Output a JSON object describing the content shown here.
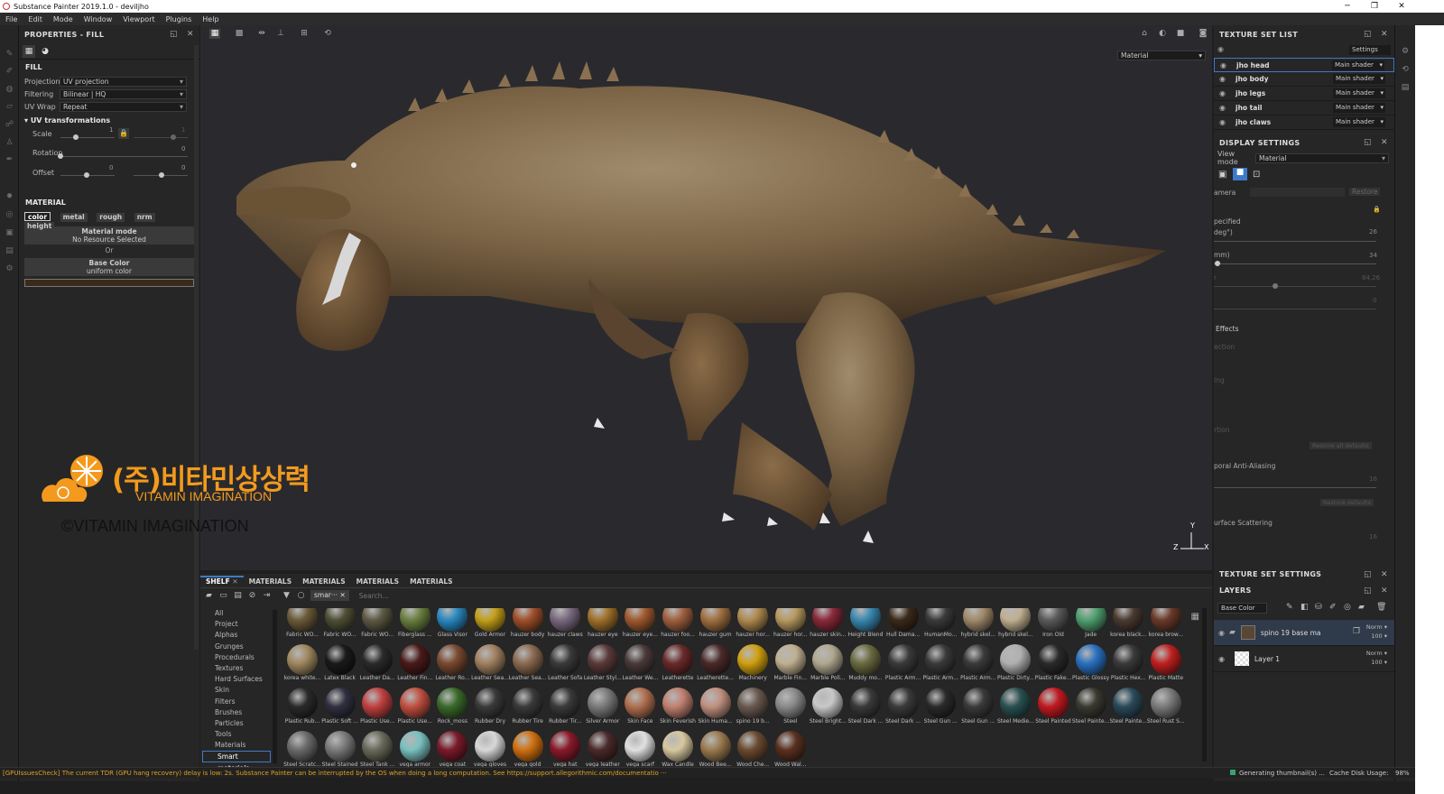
{
  "window": {
    "title": "Substance Painter 2019.1.0 - deviljho",
    "minimize": "─",
    "maximize": "❐",
    "close": "✕"
  },
  "menu": [
    "File",
    "Edit",
    "Mode",
    "Window",
    "Viewport",
    "Plugins",
    "Help"
  ],
  "props": {
    "title": "PROPERTIES - FILL",
    "fill_title": "FILL",
    "projection_label": "Projection",
    "projection_value": "UV projection",
    "filtering_label": "Filtering",
    "filtering_value": "Bilinear | HQ",
    "uvwrap_label": "UV Wrap",
    "uvwrap_value": "Repeat",
    "uvt_title": "UV transformations",
    "scale_label": "Scale",
    "scale_value": "1",
    "scale_value2": "1",
    "rotation_label": "Rotation",
    "rotation_value": "0",
    "offset_label": "Offset",
    "offset_value1": "0",
    "offset_value2": "0",
    "scale_level": 0.29,
    "scale2_level": 0.74,
    "rotation_level": 0,
    "offset1_level": 0.48,
    "offset2_level": 0.52,
    "material_title": "MATERIAL",
    "channels": [
      "color",
      "metal",
      "rough",
      "nrm",
      "height"
    ],
    "material_mode": "Material mode",
    "no_resource": "No Resource Selected",
    "or": "Or",
    "base_color": "Base Color",
    "uniform_color": "uniform color",
    "swatch_color": "#3a2a1a"
  },
  "viewport": {
    "view_mode": "Material",
    "axis_y": "Y",
    "axis_z": "Z",
    "axis_x": "X"
  },
  "logo": {
    "korean": "(주)비타민상상력",
    "english": "VITAMIN IMAGINATION",
    "copyright": "©VITAMIN IMAGINATION",
    "color": "#f39a1e"
  },
  "shelf": {
    "tabs": [
      "SHELF",
      "MATERIALS",
      "MATERIALS",
      "MATERIALS",
      "MATERIALS"
    ],
    "filter_tag": "smar···",
    "search_placeholder": "Search...",
    "categories": [
      "All",
      "Project",
      "Alphas",
      "Grunges",
      "Procedurals",
      "Textures",
      "Hard Surfaces",
      "Skin",
      "Filters",
      "Brushes",
      "Particles",
      "Tools",
      "Materials",
      "Smart materials"
    ],
    "selected_category": "Smart materials",
    "rows": [
      [
        "Fabric WO...",
        "Fabric WO...",
        "Fabric WO...",
        "Fiberglass ...",
        "Glass Visor",
        "Gold Armor",
        "hauzer body",
        "hauzer claws",
        "hauzer eye",
        "hauzer eye...",
        "hauzer foo...",
        "hauzer gum",
        "hauzer hor...",
        "hauzer hor...",
        "hauzer skin...",
        "Height Blend",
        "Hull Dama...",
        "HumanMo...",
        "hybrid skel...",
        "hybrid skel...",
        "Iron Old",
        "Jade",
        "korea black...",
        "korea brow..."
      ],
      [
        "korea white...",
        "Latex Black",
        "Leather Da...",
        "Leather Fin...",
        "Leather Ro...",
        "Leather Sea...",
        "Leather Sea...",
        "Leather Sofa",
        "Leather Styl...",
        "Leather We...",
        "Leatherette",
        "Leatherette...",
        "Machinery",
        "Marble Fin...",
        "Marble Poli...",
        "Muddy mo...",
        "Plastic Arm...",
        "Plastic Arm...",
        "Plastic Arm...",
        "Plastic Dirty...",
        "Plastic Fake...",
        "Plastic Glossy",
        "Plastic Hex...",
        "Plastic Matte"
      ],
      [
        "Plastic Rub...",
        "Plastic Soft ...",
        "Plastic Use...",
        "Plastic Use...",
        "Rock_moss",
        "Rubber Dry",
        "Rubber Tire",
        "Rubber Tir...",
        "Silver Armor",
        "Skin Face",
        "Skin Feverish",
        "Skin Huma...",
        "spino 19 b...",
        "Steel",
        "Steel Bright...",
        "Steel Dark ...",
        "Steel Dark ...",
        "Steel Gun ...",
        "Steel Gun ...",
        "Steel Medie...",
        "Steel Painted",
        "Steel Painte...",
        "Steel Painte...",
        "Steel Rust S..."
      ],
      [
        "Steel Scratc...",
        "Steel Stained",
        "Steel Tank ...",
        "vega armor",
        "vega coat",
        "vega gloves",
        "vega gold",
        "vega hat",
        "vega leather",
        "vega scarf",
        "Wax Candle",
        "Wood Bee...",
        "Wood Che...",
        "Wood Wal..."
      ]
    ],
    "colors": [
      [
        "#6b5b3a",
        "#4f4f36",
        "#5e5a44",
        "#6a8040",
        "#2a88c0",
        "#c4a01a",
        "#a0502a",
        "#7a6a80",
        "#a0702a",
        "#a05a30",
        "#a06040",
        "#a07040",
        "#b08a50",
        "#b89a60",
        "#8a2a3a",
        "#3a88b0",
        "#3a2a1a",
        "#3a3a3a",
        "#a08a6a",
        "#c0b090",
        "#5a5a5a",
        "#50a070",
        "#4a3a30",
        "#6a3a2a"
      ],
      [
        "#a08860",
        "#1a1a1a",
        "#2a2a2a",
        "#4a1a1a",
        "#7a4a30",
        "#a08060",
        "#8a6a50",
        "#3a3a3a",
        "#5a3a3a",
        "#4a3a3a",
        "#6a2a2a",
        "#4a2a2a",
        "#d0a010",
        "#c0b090",
        "#b0a890",
        "#6a6a40",
        "#3a3a3a",
        "#3a3a3a",
        "#3a3a3a",
        "#b0b0b0",
        "#2a2a2a",
        "#2a70c0",
        "#3a3a3a",
        "#c02020"
      ],
      [
        "#2a2a2a",
        "#303040",
        "#c04040",
        "#c05040",
        "#3a6a2a",
        "#3a3a3a",
        "#3a3a3a",
        "#3a3a3a",
        "#7a7a7a",
        "#b07050",
        "#c08070",
        "#c09080",
        "#6a5a50",
        "#8a8a8a",
        "#c8c8c8",
        "#3a3a3a",
        "#3a3a3a",
        "#2a2a2a",
        "#3a3a3a",
        "#2a5050",
        "#c01a20",
        "#3a3a30",
        "#2a4a5a",
        "#7a7a7a"
      ],
      [
        "#6a6a6a",
        "#7a7a7a",
        "#6a6a5a",
        "#7ac0c0",
        "#7a1a2a",
        "#d8d8d8",
        "#d07010",
        "#8a1a2a",
        "#4a2a2a",
        "#e0e0e0",
        "#d8c8a0",
        "#9a7a50",
        "#6a4a30",
        "#5a3020"
      ]
    ]
  },
  "texture_set_list": {
    "title": "TEXTURE SET LIST",
    "settings": "Settings",
    "items": [
      {
        "name": "jho head",
        "shader": "Main shader"
      },
      {
        "name": "jho body",
        "shader": "Main shader"
      },
      {
        "name": "jho legs",
        "shader": "Main shader"
      },
      {
        "name": "jho tail",
        "shader": "Main shader"
      },
      {
        "name": "jho claws",
        "shader": "Main shader"
      }
    ]
  },
  "display_settings": {
    "title": "DISPLAY SETTINGS",
    "view_mode_label": "View mode",
    "view_mode_value": "Material",
    "camera": "amera",
    "restore": "Restore",
    "specified": "pecified",
    "deg": "deg°)",
    "deg_value": "26",
    "mm": "mm)",
    "mm_value": "34",
    "v3": "84,26",
    "v4": "0",
    "effects": "Effects",
    "ection": "ection",
    "ing": "ing",
    "rtion": "rtion",
    "restore_all": "Restore all defaults",
    "aa": "poral Anti-Aliasing",
    "aa_value": "16",
    "surface": "urface Scattering",
    "surface_value": "16",
    "restore_defaults": "Restore defaults",
    "mm_level": 0.02,
    "v3_level": 0.38
  },
  "texture_set_settings": {
    "title": "TEXTURE SET SETTINGS"
  },
  "layers": {
    "title": "LAYERS",
    "channel": "Base Color",
    "items": [
      {
        "name": "spino 19 base ma",
        "blend": "Norm",
        "opacity": "100"
      },
      {
        "name": "Layer 1",
        "blend": "Norm",
        "opacity": "100"
      }
    ]
  },
  "status": {
    "message": "[GPUIssuesCheck] The current TDR (GPU hang recovery) delay is low: 2s. Substance Painter can be interrupted by the OS when doing a long computation. See https://support.allegorithmic.com/documentatio ···",
    "generating": "Generating thumbnail(s) ...",
    "cache": "Cache Disk Usage:",
    "cache_value": "98%"
  }
}
